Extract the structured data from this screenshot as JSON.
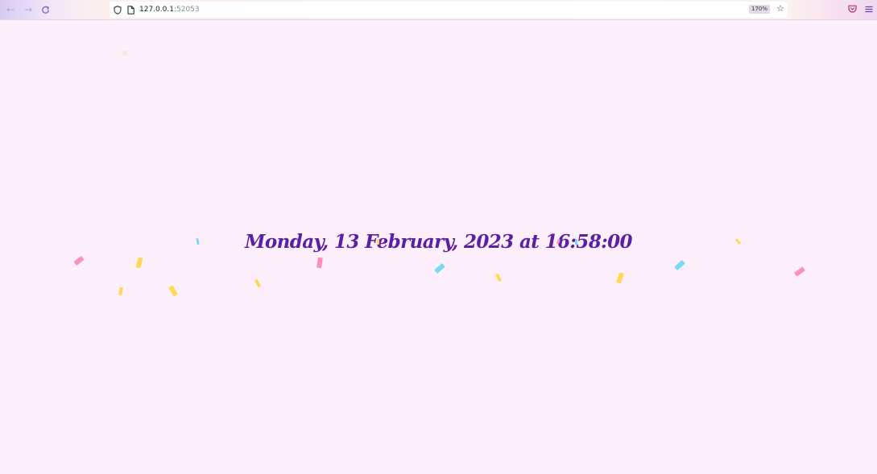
{
  "browser": {
    "url_host": "127.0.0.1",
    "url_port": ":52053",
    "zoom": "170%",
    "icons": {
      "back": "arrow-left-icon",
      "forward": "arrow-right-icon",
      "reload": "reload-icon",
      "tracking": "shield-icon",
      "page": "page-icon",
      "bookmark": "star-icon",
      "pocket": "pocket-icon",
      "menu": "hamburger-menu-icon"
    }
  },
  "page": {
    "datetime_text": "Monday, 13 February, 2023 at 16:58:00"
  },
  "colors": {
    "background": "#fdeffb",
    "text": "#5a1fa6",
    "confetti_pink": "#ff8fb8",
    "confetti_yellow": "#ffd95a",
    "confetti_blue": "#7ad8f5"
  }
}
